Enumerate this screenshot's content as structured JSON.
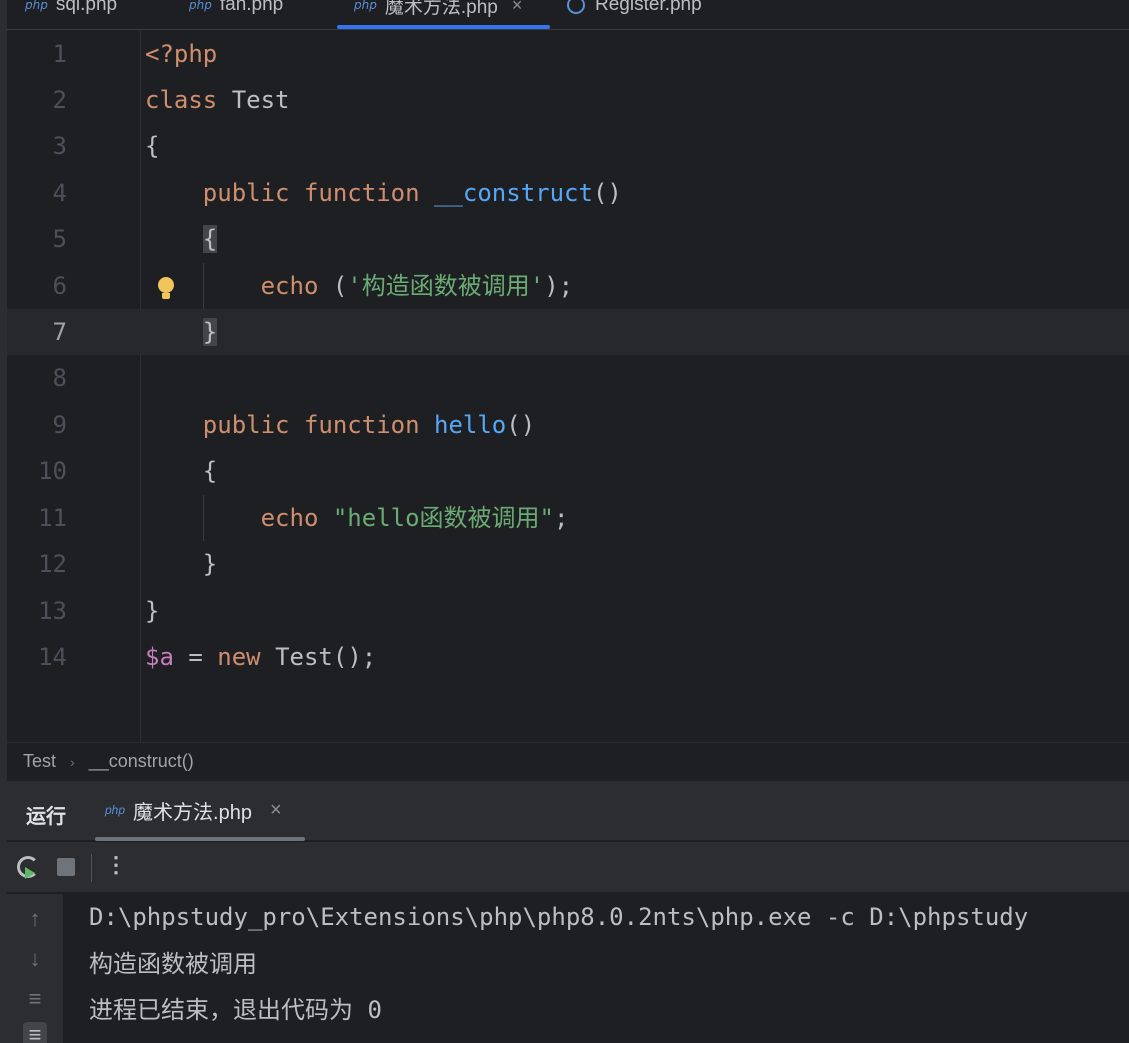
{
  "tabs": [
    {
      "label": "sql.php",
      "icon": "php"
    },
    {
      "label": "fan.php",
      "icon": "php"
    },
    {
      "label": "魔术方法.php",
      "icon": "php",
      "active": true,
      "close": "×"
    },
    {
      "label": "Register.php",
      "icon": "class"
    }
  ],
  "editor": {
    "line_numbers": [
      "1",
      "2",
      "3",
      "4",
      "5",
      "6",
      "7",
      "8",
      "9",
      "10",
      "11",
      "12",
      "13",
      "14"
    ],
    "current_line": 7,
    "code": {
      "l1_open": "<?php",
      "l2_class": "class",
      "l2_name": " Test",
      "l3": "{",
      "l4_public": "public",
      "l4_function": "function",
      "l4_name": "__construct",
      "l4_parens": "()",
      "l5": "{",
      "l6_echo": "echo",
      "l6_open": " (",
      "l6_str": "'构造函数被调用'",
      "l6_close": ");",
      "l7": "}",
      "l9_public": "public",
      "l9_function": "function",
      "l9_name": "hello",
      "l9_parens": "()",
      "l10": "{",
      "l11_echo": "echo",
      "l11_str": "\"hello函数被调用\"",
      "l11_semi": ";",
      "l12": "}",
      "l13": "}",
      "l14_var": "$a",
      "l14_eq": " = ",
      "l14_new": "new",
      "l14_rest": " Test();"
    }
  },
  "breadcrumb": {
    "items": [
      "Test",
      "__construct()"
    ],
    "sep": "›"
  },
  "run": {
    "title": "运行",
    "tab_label": "魔术方法.php",
    "tab_close": "×",
    "more": "⋮"
  },
  "console": {
    "lines": [
      "D:\\phpstudy_pro\\Extensions\\php\\php8.0.2nts\\php.exe -c D:\\phpstudy",
      "构造函数被调用",
      "进程已结束，退出代码为 0"
    ]
  },
  "colors": {
    "accent": "#3574f0",
    "keyword": "#cf8e6d",
    "function": "#56a8f5",
    "string": "#6aab73",
    "variable": "#c77dbb"
  }
}
